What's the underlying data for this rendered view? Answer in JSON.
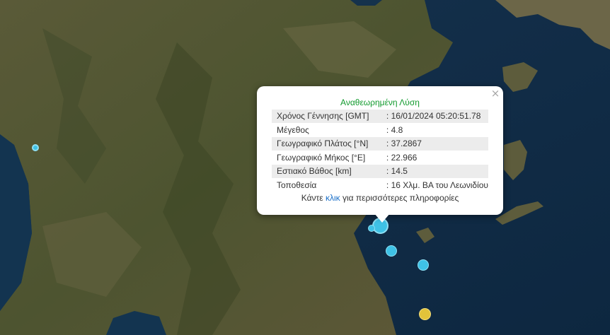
{
  "popup": {
    "title": "Αναθεωρημένη Λύση",
    "rows": [
      {
        "label": "Χρόνος Γέννησης [GMT]",
        "value": ": 16/01/2024 05:20:51.78"
      },
      {
        "label": "Μέγεθος",
        "value": ": 4.8"
      },
      {
        "label": "Γεωγραφικό Πλάτος [°N]",
        "value": ": 37.2867"
      },
      {
        "label": "Γεωγραφικό Μήκος [°E]",
        "value": ": 22.966"
      },
      {
        "label": "Εστιακό Βάθος [km]",
        "value": ": 14.5"
      },
      {
        "label": "Τοποθεσία",
        "value": ": 16 Χλμ. ΒΑ του Λεωνιδίου"
      }
    ],
    "more_prefix": "Κάντε ",
    "more_link": "κλικ",
    "more_suffix": " για περισσότερες πληροφορίες",
    "close_icon": "close-icon"
  },
  "colors": {
    "land": "#4f5530",
    "sea": "#0f2c47",
    "quake_recent": "#3fc2e6",
    "quake_older": "#e2c33a",
    "title_green": "#119a2d",
    "link_blue": "#1a6fc8"
  },
  "map": {
    "basemap": "satellite imagery"
  }
}
